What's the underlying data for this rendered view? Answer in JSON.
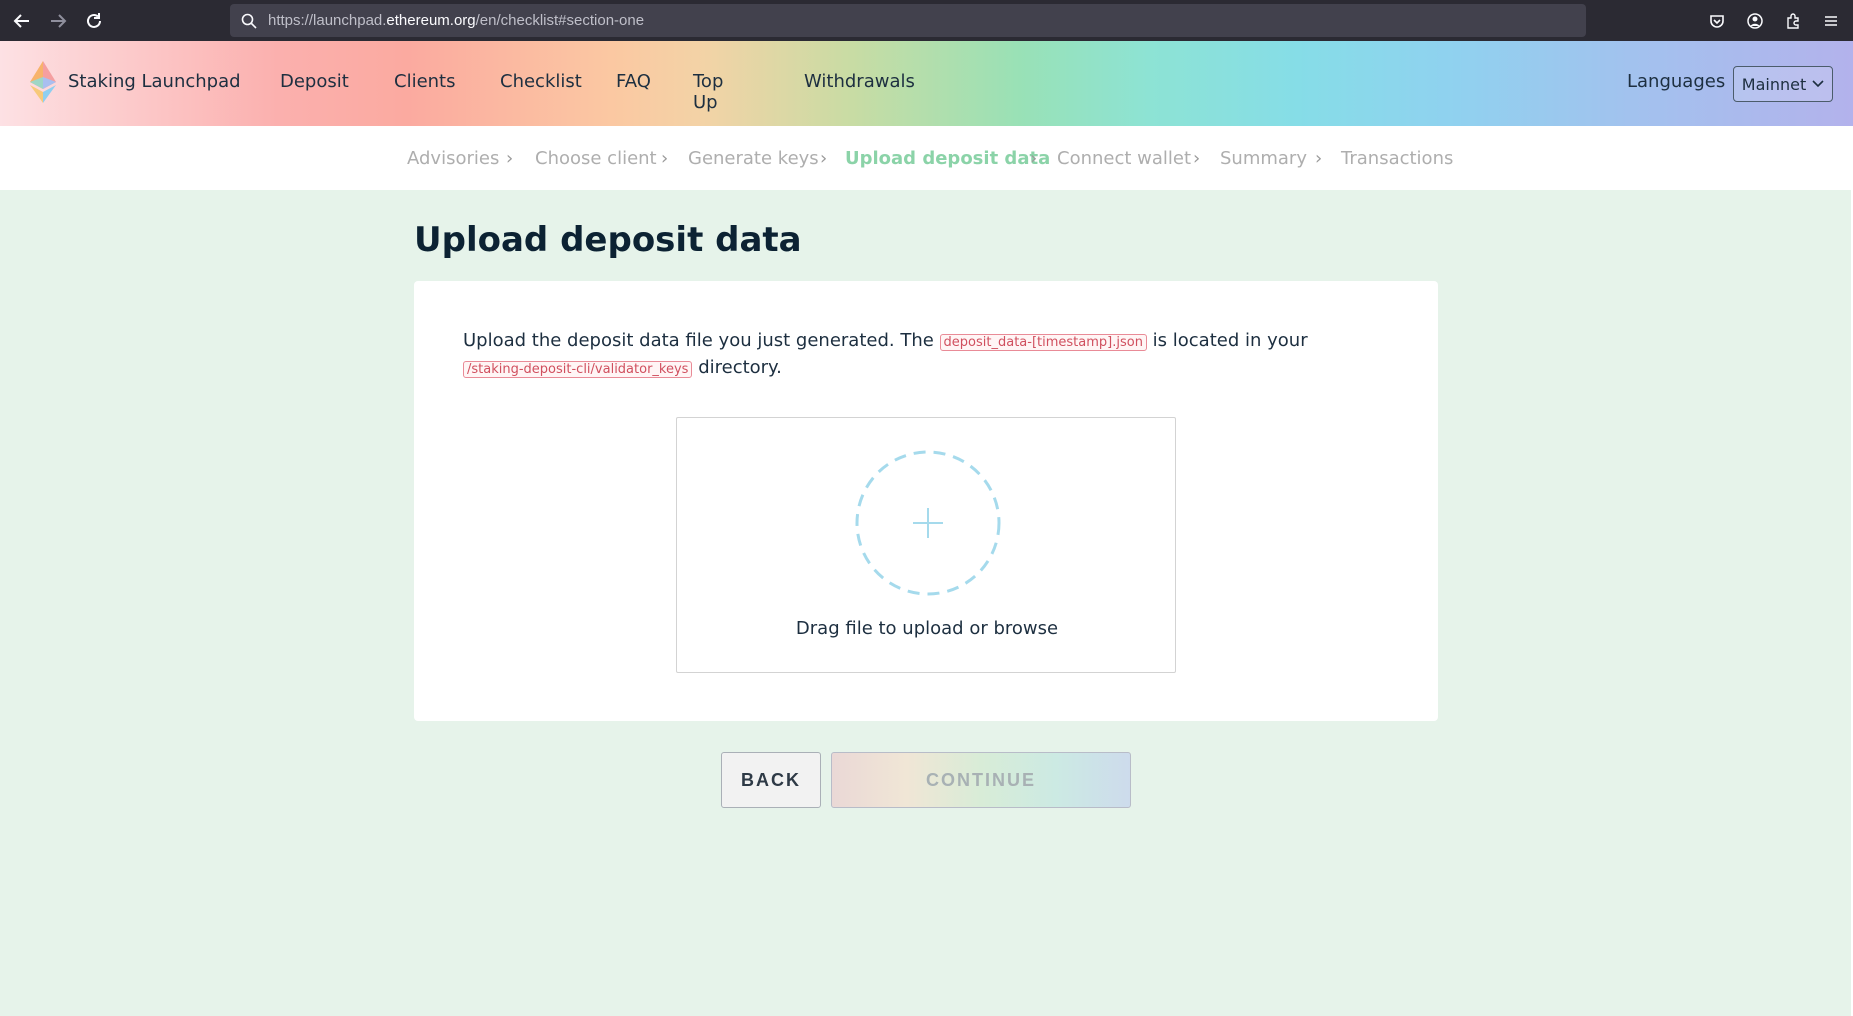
{
  "browser": {
    "url_prefix": "https://launchpad.",
    "url_host": "ethereum.org",
    "url_path": "/en/checklist#section-one"
  },
  "header": {
    "brand": "Staking Launchpad",
    "nav": [
      "Deposit",
      "Clients",
      "Checklist",
      "FAQ",
      "Top Up",
      "Withdrawals"
    ],
    "languages": "Languages",
    "network": "Mainnet"
  },
  "stepper": {
    "steps": [
      "Advisories",
      "Choose client",
      "Generate keys",
      "Upload deposit data",
      "Connect wallet",
      "Summary",
      "Transactions"
    ],
    "active_index": 3
  },
  "page": {
    "title": "Upload deposit data",
    "desc_part1": "Upload the deposit data file you just generated. The",
    "desc_code1": "deposit_data-[timestamp].json",
    "desc_part2": "is located in your",
    "desc_code2": "/staking-deposit-cli/validator_keys",
    "desc_part3": "directory.",
    "dropzone_text": "Drag file to upload or browse",
    "back_label": "BACK",
    "continue_label": "CONTINUE"
  },
  "colors": {
    "active_step": "#8bd3a8",
    "title": "#0c2233",
    "code_text": "#d0505f",
    "dropzone_circle": "#a5daec",
    "background": "#e6f3ea"
  }
}
